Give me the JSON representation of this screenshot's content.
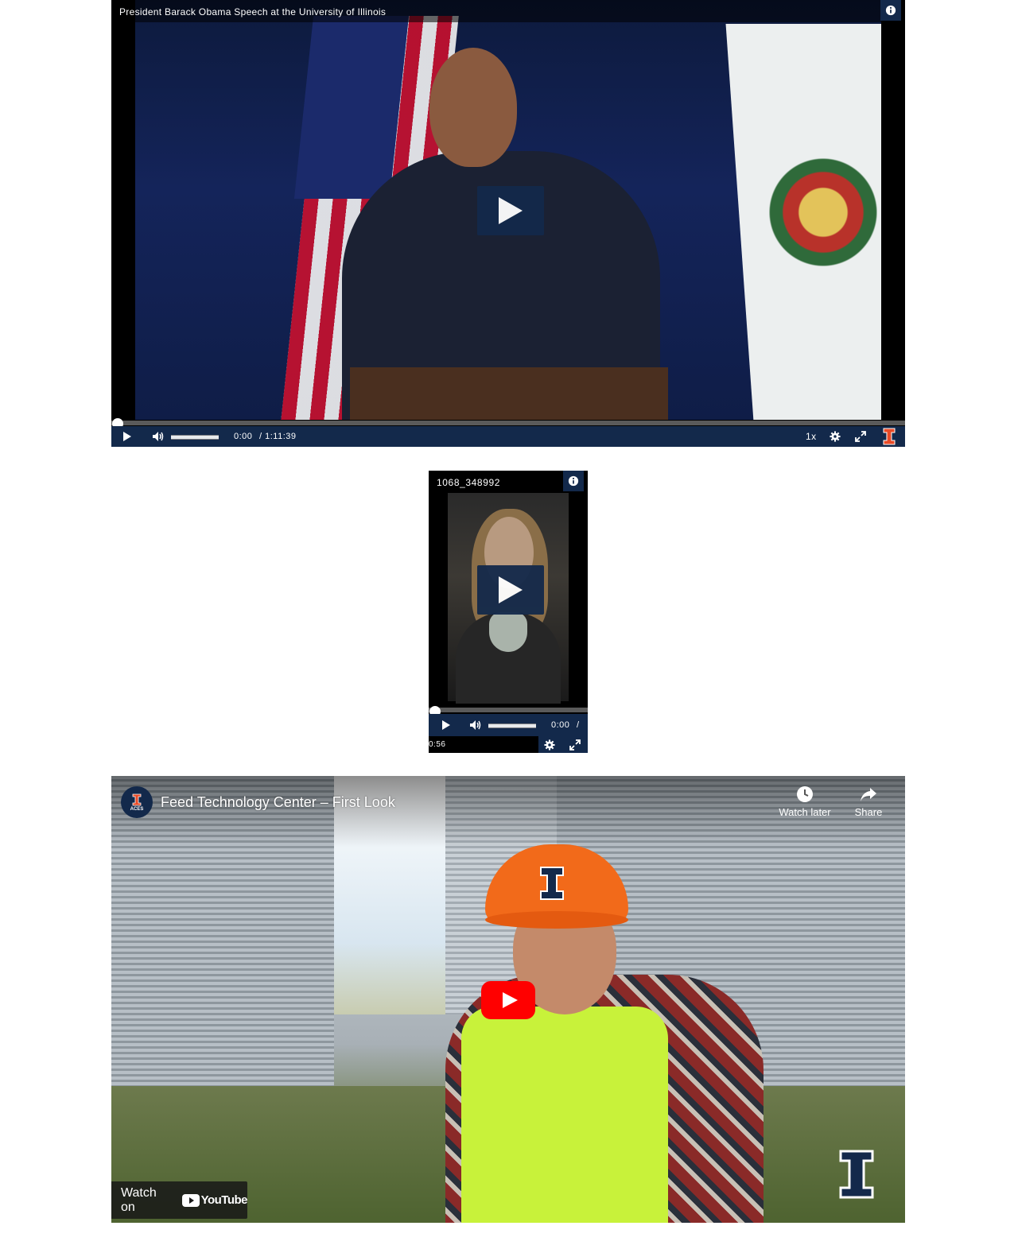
{
  "player1": {
    "title": "President Barack Obama Speech at the University of Illinois",
    "time_current": "0:00",
    "time_total": "/ 1:11:39",
    "speed": "1x"
  },
  "player2": {
    "title": "1068_348992",
    "time_current": "0:00",
    "time_separator": "/",
    "time_total": "0:56"
  },
  "player3": {
    "channel_avatar_label": "ACES",
    "title": "Feed Technology Center – First Look",
    "watch_later_label": "Watch later",
    "share_label": "Share",
    "watch_on_label": "Watch on",
    "youtube_brand": "YouTube"
  },
  "colors": {
    "illinois_blue": "#13294b",
    "illinois_orange": "#e84a27",
    "youtube_red": "#ff0000"
  }
}
